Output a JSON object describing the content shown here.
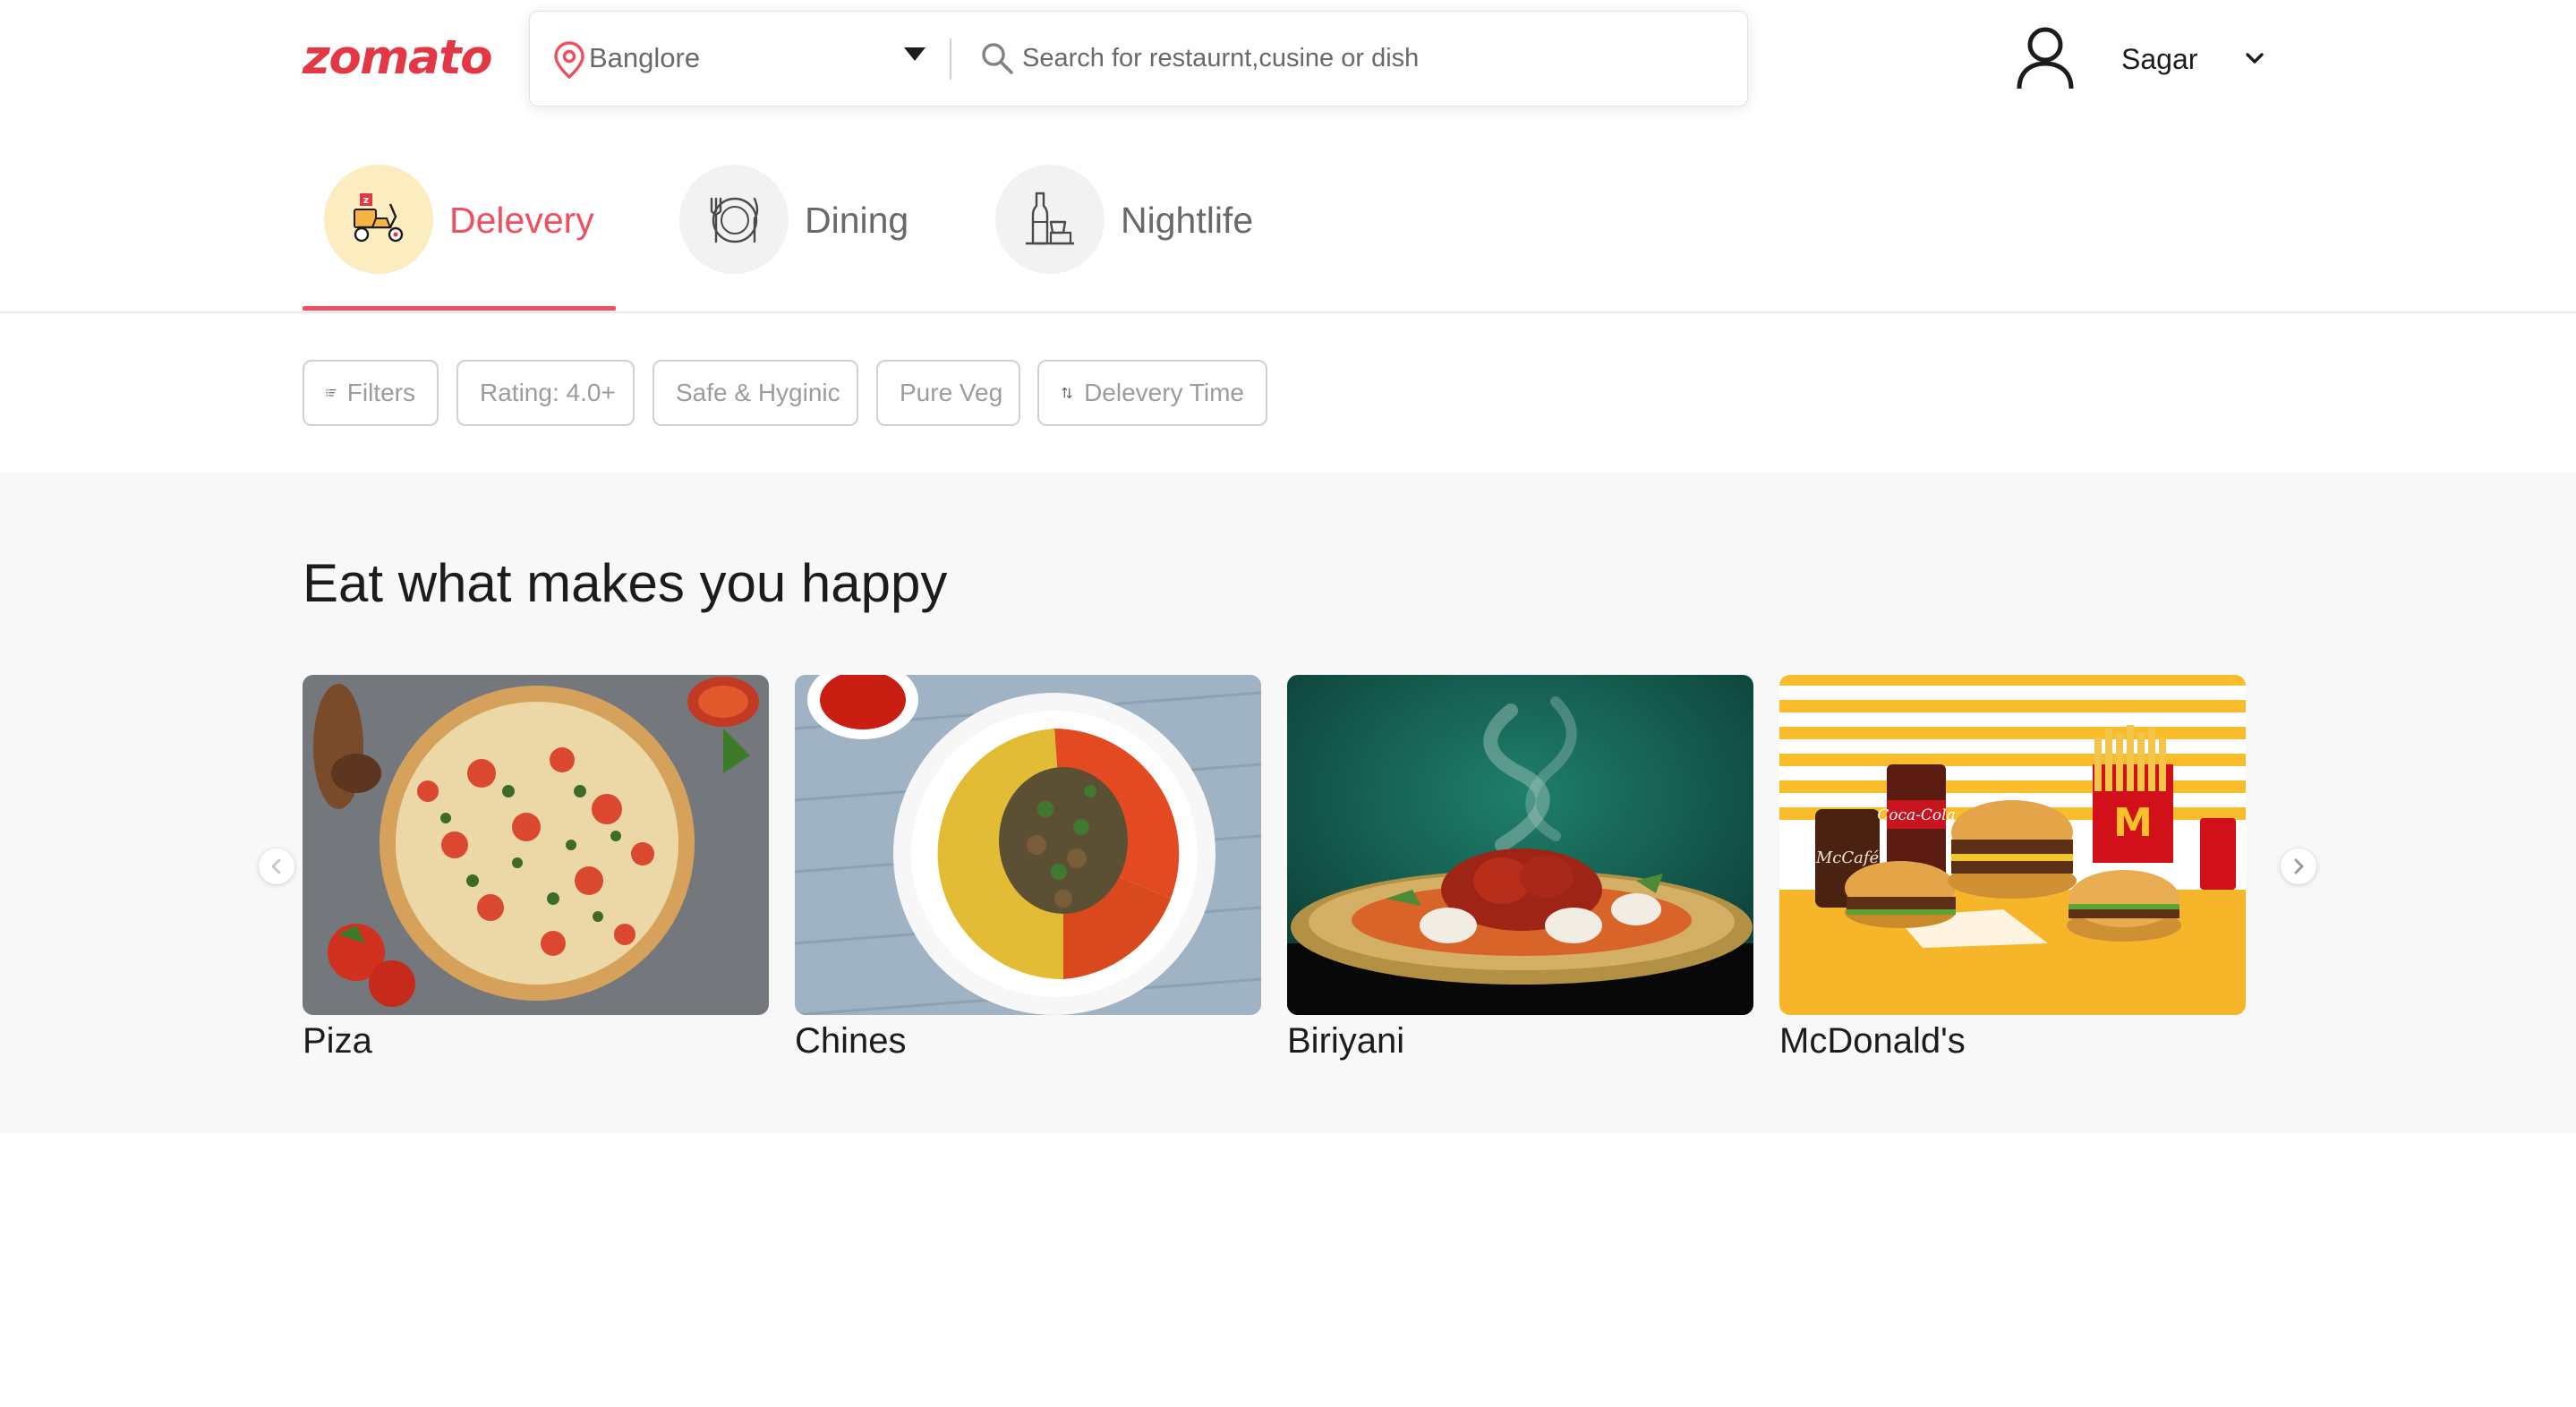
{
  "brand": {
    "logo_text": "zomato",
    "accent_color": "#e23744"
  },
  "search": {
    "location": "Banglore",
    "placeholder": "Search for restaurnt,cusine or dish",
    "location_icon": "location-pin-icon",
    "search_icon": "search-icon"
  },
  "user": {
    "name": "Sagar",
    "icon": "user-icon"
  },
  "tabs": [
    {
      "label": "Delevery",
      "icon": "scooter-icon",
      "active": true
    },
    {
      "label": "Dining",
      "icon": "dining-icon",
      "active": false
    },
    {
      "label": "Nightlife",
      "icon": "bottles-icon",
      "active": false
    }
  ],
  "filters": [
    {
      "label": "Filters",
      "icon": "filter-list-icon"
    },
    {
      "label": "Rating: 4.0+"
    },
    {
      "label": "Safe & Hyginic"
    },
    {
      "label": "Pure Veg"
    },
    {
      "label": "Delevery Time",
      "icon": "sort-icon"
    }
  ],
  "collection": {
    "title": "Eat what makes you happy",
    "items": [
      {
        "title": "Piza",
        "image": "pizza-image"
      },
      {
        "title": "Chines",
        "image": "chinese-food-image"
      },
      {
        "title": "Biriyani",
        "image": "biryani-image"
      },
      {
        "title": "McDonald's",
        "image": "mcdonalds-image"
      }
    ]
  }
}
